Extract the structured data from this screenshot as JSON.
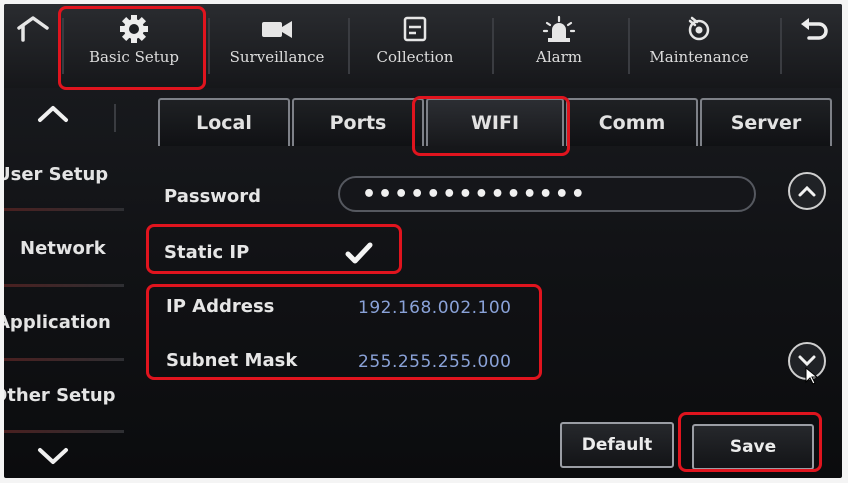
{
  "topnav": {
    "basic_setup": "Basic Setup",
    "surveillance": "Surveillance",
    "collection": "Collection",
    "alarm": "Alarm",
    "maintenance": "Maintenance"
  },
  "sidebar": {
    "items": [
      {
        "label": "User Setup"
      },
      {
        "label": "Network"
      },
      {
        "label": "Application"
      },
      {
        "label": "Other Setup"
      }
    ]
  },
  "tabs": [
    {
      "label": "Local"
    },
    {
      "label": "Ports"
    },
    {
      "label": "WIFI"
    },
    {
      "label": "Comm"
    },
    {
      "label": "Server"
    }
  ],
  "form": {
    "password_label": "Password",
    "password_value": "••••••••••••••",
    "static_ip_label": "Static IP",
    "static_ip_checked": true,
    "ip_label": "IP Address",
    "ip_value": "192.168.002.100",
    "subnet_label": "Subnet Mask",
    "subnet_value": "255.255.255.000"
  },
  "buttons": {
    "default": "Default",
    "save": "Save"
  },
  "colors": {
    "highlight": "#e0141e",
    "value_text": "#8aa2d8"
  }
}
